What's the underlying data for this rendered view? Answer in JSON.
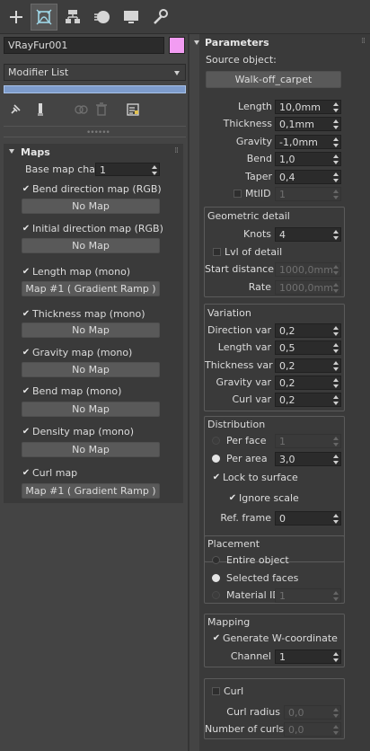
{
  "tabs": [
    {
      "icon": "create-icon"
    },
    {
      "icon": "modify-icon"
    },
    {
      "icon": "hierarchy-icon"
    },
    {
      "icon": "motion-icon"
    },
    {
      "icon": "display-icon"
    },
    {
      "icon": "utilities-icon"
    }
  ],
  "object_name": "VRayFur001",
  "object_color": "#f29cf2",
  "modifier_list_label": "Modifier List",
  "maps": {
    "title": "Maps",
    "base_map_chan_label": "Base map chan",
    "base_map_chan_value": "1",
    "items": [
      {
        "label": "Bend direction map (RGB)",
        "button": "No Map"
      },
      {
        "label": "Initial direction map (RGB)",
        "button": "No Map"
      },
      {
        "label": "Length map (mono)",
        "button": "Map #1  ( Gradient Ramp )"
      },
      {
        "label": "Thickness map (mono)",
        "button": "No Map"
      },
      {
        "label": "Gravity map (mono)",
        "button": "No Map"
      },
      {
        "label": "Bend map (mono)",
        "button": "No Map"
      },
      {
        "label": "Density map (mono)",
        "button": "No Map"
      },
      {
        "label": "Curl map",
        "button": "Map #1  ( Gradient Ramp )"
      }
    ]
  },
  "params": {
    "title": "Parameters",
    "source_label": "Source object:",
    "source_button": "Walk-off_carpet",
    "length_label": "Length",
    "length_value": "10,0mm",
    "thickness_label": "Thickness",
    "thickness_value": "0,1mm",
    "gravity_label": "Gravity",
    "gravity_value": "-1,0mm",
    "bend_label": "Bend",
    "bend_value": "1,0",
    "taper_label": "Taper",
    "taper_value": "0,4",
    "mtlid_label": "MtlID",
    "mtlid_value": "1",
    "geo": {
      "title": "Geometric detail",
      "knots_label": "Knots",
      "knots_value": "4",
      "lvl_label": "Lvl of detail",
      "start_label": "Start distance",
      "start_value": "1000,0mm",
      "rate_label": "Rate",
      "rate_value": "1000,0mm"
    },
    "variation": {
      "title": "Variation",
      "direction_label": "Direction var",
      "direction_value": "0,2",
      "length_label": "Length var",
      "length_value": "0,5",
      "thickness_label": "Thickness var",
      "thickness_value": "0,2",
      "gravity_label": "Gravity var",
      "gravity_value": "0,2",
      "curl_label": "Curl var",
      "curl_value": "0,2"
    },
    "distribution": {
      "title": "Distribution",
      "per_face_label": "Per face",
      "per_face_value": "1",
      "per_area_label": "Per area",
      "per_area_value": "3,0",
      "lock_label": "Lock to surface",
      "ignore_label": "Ignore scale",
      "ref_label": "Ref. frame",
      "ref_value": "0"
    },
    "placement": {
      "title": "Placement",
      "entire_label": "Entire object",
      "selected_label": "Selected faces",
      "material_label": "Material ID",
      "material_value": "1"
    },
    "mapping": {
      "title": "Mapping",
      "generate_label": "Generate W-coordinate",
      "channel_label": "Channel",
      "channel_value": "1"
    },
    "curl": {
      "curl_label": "Curl",
      "radius_label": "Curl radius",
      "radius_value": "0,0",
      "count_label": "Number of curls",
      "count_value": "0,0"
    }
  }
}
